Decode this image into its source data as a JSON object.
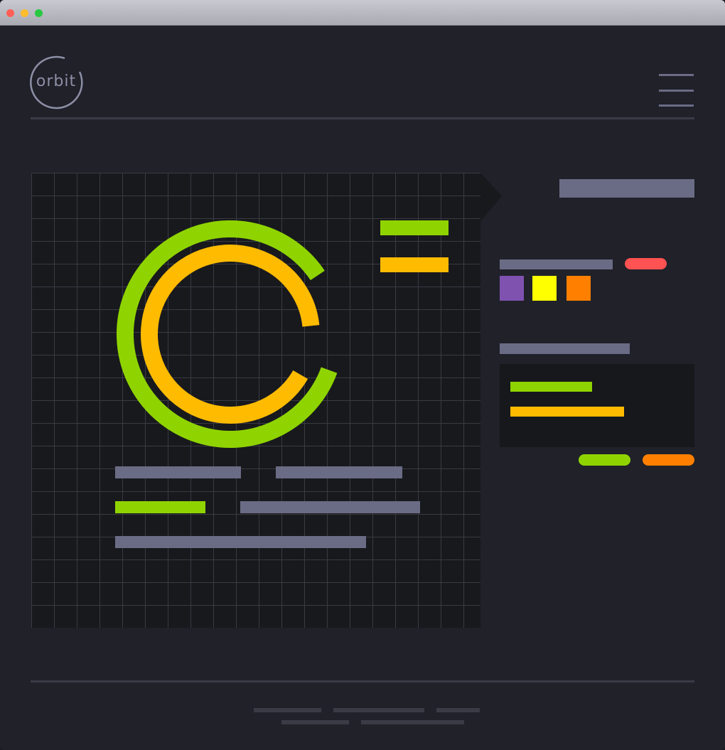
{
  "window": {
    "controls": [
      "close",
      "minimize",
      "zoom"
    ]
  },
  "header": {
    "logo_text": "orbit",
    "menu_icon": "hamburger-icon"
  },
  "colors": {
    "accent_green": "#8fd400",
    "accent_amber": "#ffbb00",
    "placeholder_gray": "#6a6c85",
    "status_red": "#ff5252",
    "swatch_purple": "#7f52b0",
    "swatch_yellow": "#ffff00",
    "swatch_orange": "#ff8000"
  },
  "chart_data": {
    "type": "radial-bar",
    "series": [
      {
        "color": "#8fd400",
        "value": 0.85
      },
      {
        "color": "#ffbb00",
        "value": 0.9
      }
    ]
  },
  "sidebar": {
    "swatches": [
      "#7f52b0",
      "#ffff00",
      "#ff8000"
    ],
    "pills": [
      "#8fd400",
      "#ff8000"
    ]
  }
}
